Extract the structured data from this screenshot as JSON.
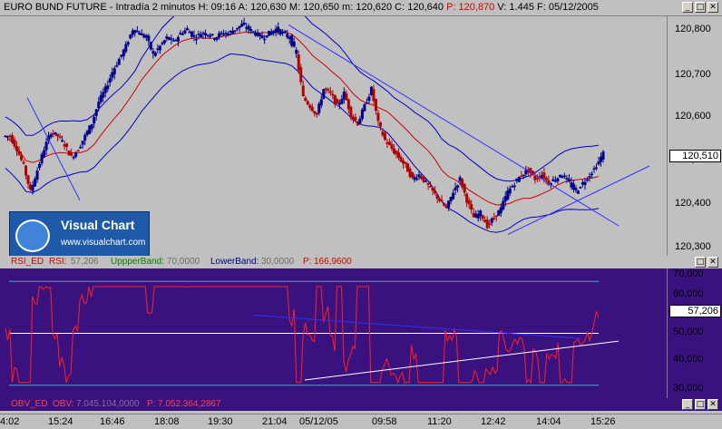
{
  "title": {
    "instrument": "EURO BUND FUTURE",
    "timeframe": "Intradía 2 minutos",
    "h_label": "H:",
    "h_value": "09:16",
    "a_label": "A:",
    "a_value": "120,630",
    "m_label": "M:",
    "m_value": "120,650",
    "mi_label": "m:",
    "mi_value": "120,620",
    "c_label": "C:",
    "c_value": "120,640",
    "p_label": "P:",
    "p_value": "120,870",
    "vol_label": "V:",
    "vol_value": "1.445",
    "f_label": "F:",
    "f_value": "05/12/2005"
  },
  "colors": {
    "panel_bg": "#c0c0c0",
    "indicator_bg": "#3a1280",
    "candle": "#00008b",
    "candle_down": "#b00000",
    "moving_average": "#d00000",
    "band": "#0000c0",
    "rsi_line": "#ff2020",
    "level_line": "#20c0c0",
    "trendline": "#3030ff",
    "trendline_rsi": "#ffffff"
  },
  "price_axis": {
    "ticks": [
      "120,800",
      "120,700",
      "120,600",
      "120,500",
      "120,400",
      "120,300"
    ],
    "current": "120,510"
  },
  "rsi_header": {
    "name": "RSI_ED",
    "rsi_label": "RSI:",
    "rsi_value": "57,206",
    "upper_label": "UppperBand:",
    "upper_value": "70,0000",
    "lower_label": "LowerBand:",
    "lower_value": "30,0000",
    "p_label": "P:",
    "p_value": "166,9600"
  },
  "rsi_axis": {
    "ticks": [
      "70,000",
      "60,000",
      "50,000",
      "40,000",
      "30,000"
    ],
    "current": "57,206"
  },
  "obv_header": {
    "name": "OBV_ED",
    "obv_label": "OBV:",
    "obv_value": "7.045.104,0000",
    "p_label": "P:",
    "p_value": "7.052.364,2867"
  },
  "time_axis": [
    "4:02",
    "15:24",
    "16:46",
    "18:08",
    "19:30",
    "21:04",
    "05/12/05",
    "09:58",
    "11:20",
    "12:42",
    "14:04",
    "15:26"
  ],
  "logo": {
    "name": "Visual Chart",
    "url": "www.visualchart.com"
  },
  "window_buttons": {
    "minimize": "_",
    "restore": "□",
    "close": "✕"
  },
  "chart_data": {
    "type": "candlestick",
    "title": "EURO BUND FUTURE - Intradía 2 minutos",
    "y_range": [
      120.27,
      120.83
    ],
    "close_path": [
      120.55,
      120.52,
      120.48,
      120.42,
      120.47,
      120.52,
      120.56,
      120.55,
      120.53,
      120.5,
      120.52,
      120.55,
      120.58,
      120.63,
      120.66,
      120.7,
      120.73,
      120.76,
      120.8,
      120.79,
      120.78,
      120.74,
      120.76,
      120.78,
      120.77,
      120.79,
      120.8,
      120.78,
      120.79,
      120.79,
      120.78,
      120.79,
      120.79,
      120.8,
      120.81,
      120.8,
      120.79,
      120.78,
      120.79,
      120.8,
      120.79,
      120.78,
      120.74,
      120.64,
      120.62,
      120.6,
      120.66,
      120.65,
      120.62,
      120.65,
      120.6,
      120.58,
      120.62,
      120.66,
      120.58,
      120.54,
      120.52,
      120.5,
      120.48,
      120.45,
      120.46,
      120.44,
      120.42,
      120.4,
      120.38,
      120.42,
      120.45,
      120.4,
      120.36,
      120.37,
      120.34,
      120.36,
      120.38,
      120.42,
      120.44,
      120.46,
      120.47,
      120.45,
      120.46,
      120.44,
      120.45,
      120.46,
      120.44,
      120.42,
      120.44,
      120.46,
      120.48,
      120.51
    ],
    "rsi_levels": [
      70,
      50,
      30
    ],
    "rsi_range": [
      25,
      75
    ]
  }
}
